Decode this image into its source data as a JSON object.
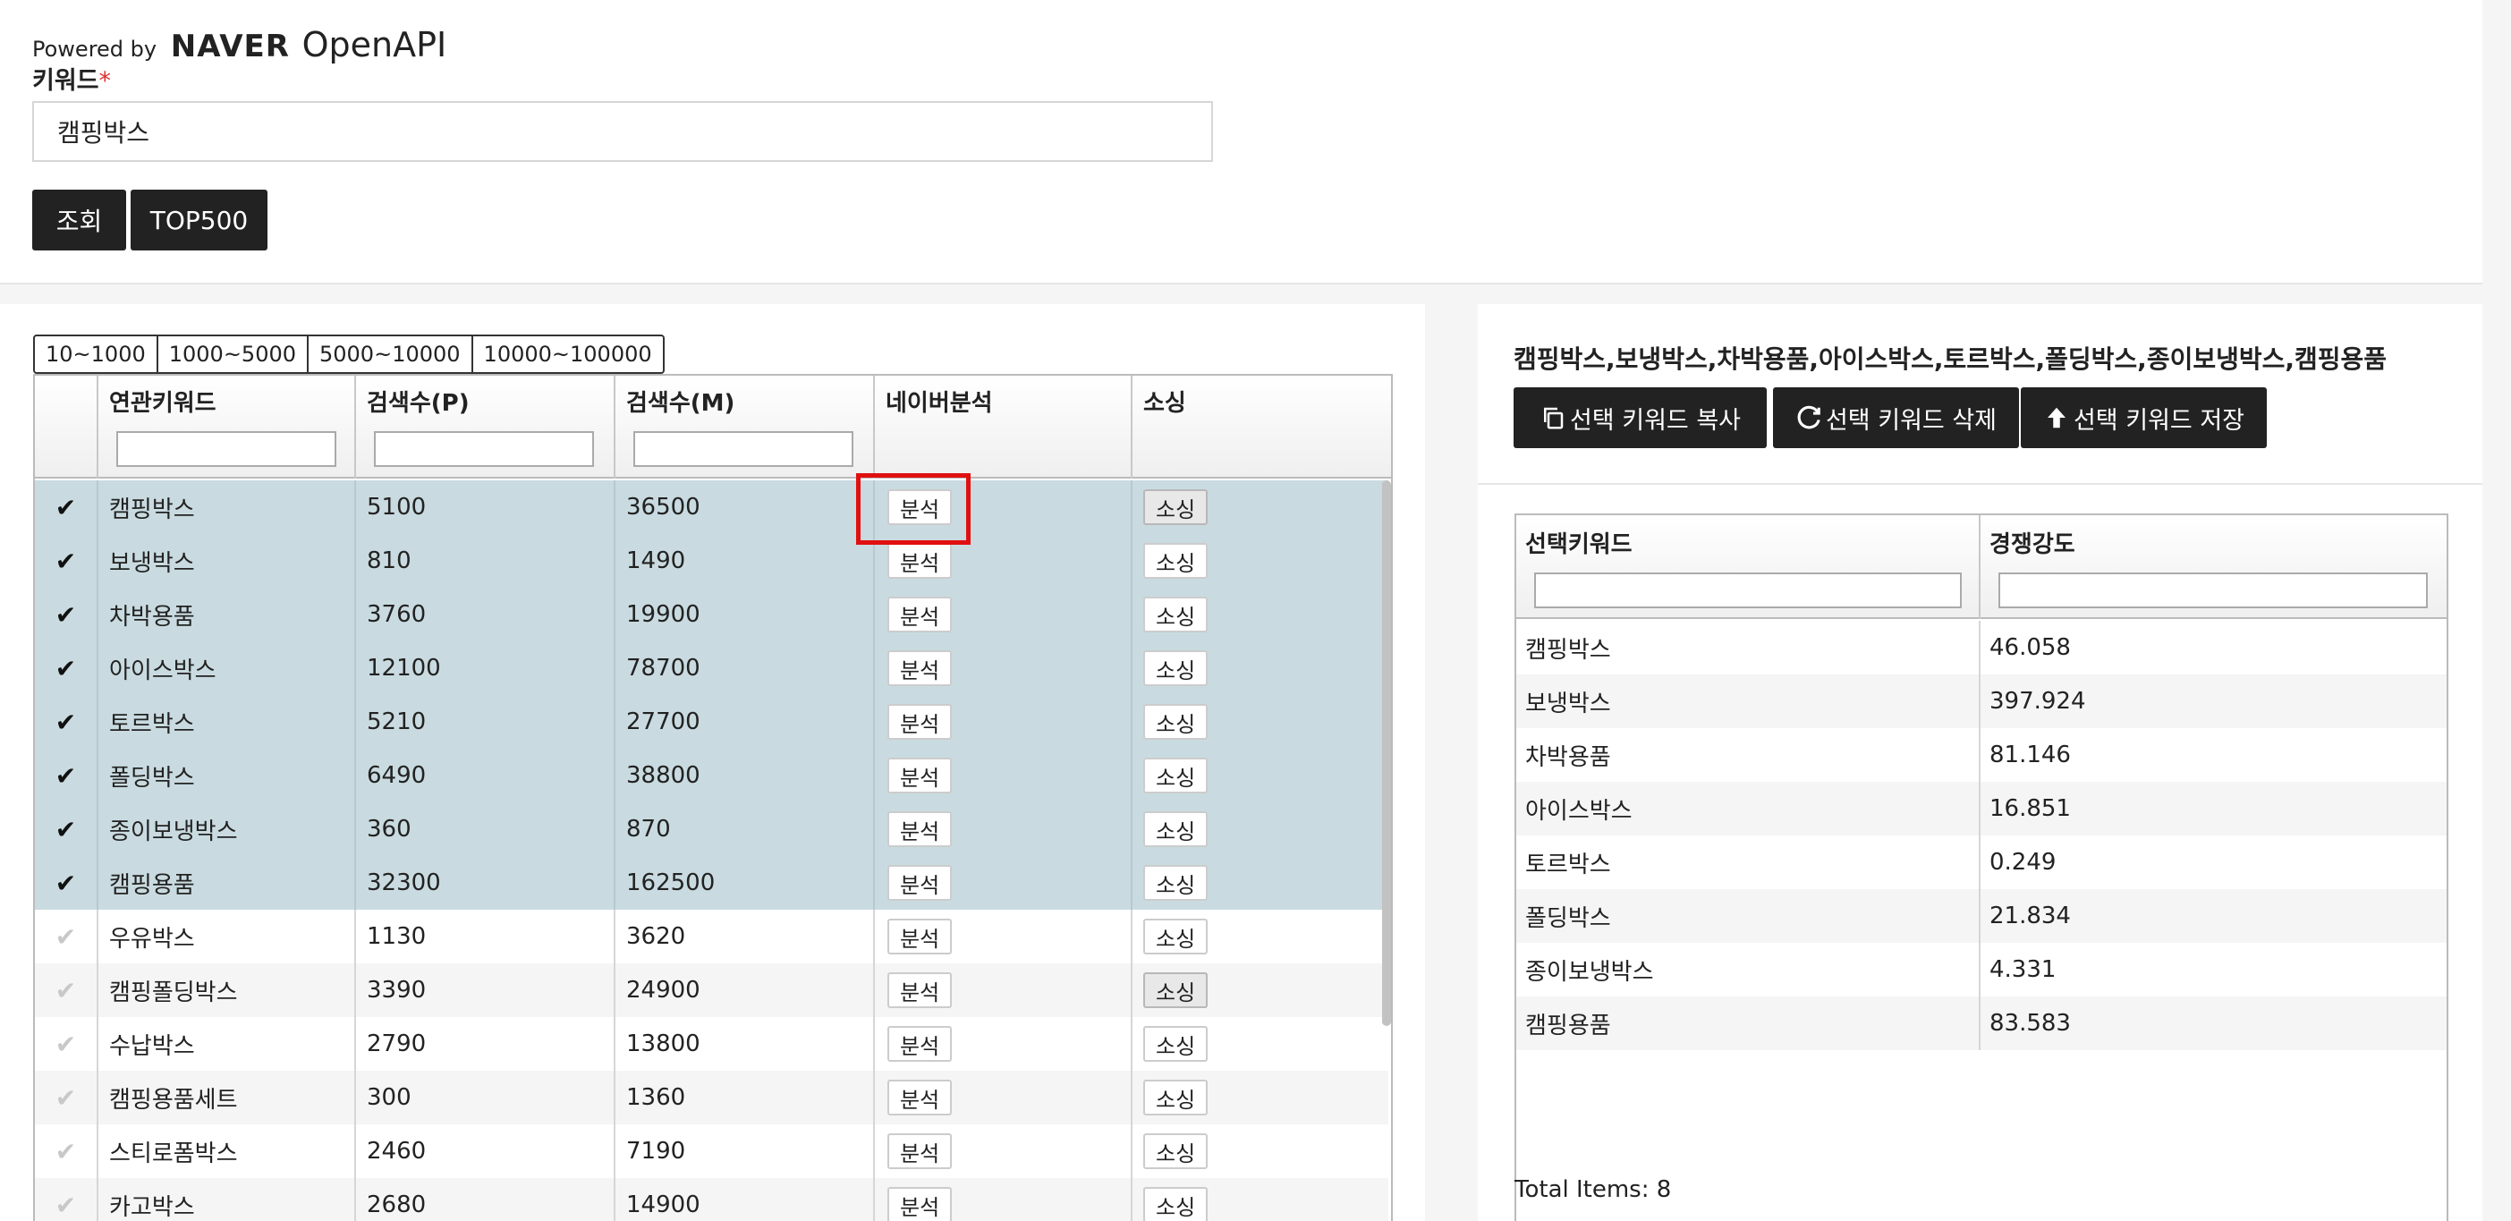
{
  "header": {
    "powered_by": "Powered by",
    "brand": "NAVER",
    "product": "OpenAPI",
    "keyword_label": "키워드",
    "required_mark": "*",
    "keyword_value": "캠핑박스",
    "search_button": "조회",
    "top500_button": "TOP500"
  },
  "ranges": [
    "10~1000",
    "1000~5000",
    "5000~10000",
    "10000~100000"
  ],
  "left_grid": {
    "columns": [
      "연관키워드",
      "검색수(P)",
      "검색수(M)",
      "네이버분석",
      "소싱"
    ],
    "analyze_label": "분석",
    "source_label": "소싱",
    "rows": [
      {
        "keyword": "캠핑박스",
        "pc": "5100",
        "mobile": "36500",
        "selected": true
      },
      {
        "keyword": "보냉박스",
        "pc": "810",
        "mobile": "1490",
        "selected": true
      },
      {
        "keyword": "차박용품",
        "pc": "3760",
        "mobile": "19900",
        "selected": true
      },
      {
        "keyword": "아이스박스",
        "pc": "12100",
        "mobile": "78700",
        "selected": true
      },
      {
        "keyword": "토르박스",
        "pc": "5210",
        "mobile": "27700",
        "selected": true
      },
      {
        "keyword": "폴딩박스",
        "pc": "6490",
        "mobile": "38800",
        "selected": true
      },
      {
        "keyword": "종이보냉박스",
        "pc": "360",
        "mobile": "870",
        "selected": true
      },
      {
        "keyword": "캠핑용품",
        "pc": "32300",
        "mobile": "162500",
        "selected": true
      },
      {
        "keyword": "우유박스",
        "pc": "1130",
        "mobile": "3620",
        "selected": false
      },
      {
        "keyword": "캠핑폴딩박스",
        "pc": "3390",
        "mobile": "24900",
        "selected": false
      },
      {
        "keyword": "수납박스",
        "pc": "2790",
        "mobile": "13800",
        "selected": false
      },
      {
        "keyword": "캠핑용품세트",
        "pc": "300",
        "mobile": "1360",
        "selected": false
      },
      {
        "keyword": "스티로폼박스",
        "pc": "2460",
        "mobile": "7190",
        "selected": false
      },
      {
        "keyword": "카고박스",
        "pc": "2680",
        "mobile": "14900",
        "selected": false
      }
    ]
  },
  "right_panel": {
    "selected_keywords": "캠핑박스,보냉박스,차박용품,아이스박스,토르박스,폴딩박스,종이보냉박스,캠핑용품",
    "copy_button": "선택 키워드 복사",
    "delete_button": "선택 키워드 삭제",
    "save_button": "선택 키워드 저장",
    "columns": [
      "선택키워드",
      "경쟁강도"
    ],
    "rows": [
      {
        "keyword": "캠핑박스",
        "competition": "46.058"
      },
      {
        "keyword": "보냉박스",
        "competition": "397.924"
      },
      {
        "keyword": "차박용품",
        "competition": "81.146"
      },
      {
        "keyword": "아이스박스",
        "competition": "16.851"
      },
      {
        "keyword": "토르박스",
        "competition": "0.249"
      },
      {
        "keyword": "폴딩박스",
        "competition": "21.834"
      },
      {
        "keyword": "종이보냉박스",
        "competition": "4.331"
      },
      {
        "keyword": "캠핑용품",
        "competition": "83.583"
      }
    ],
    "total_items": "Total Items: 8"
  }
}
